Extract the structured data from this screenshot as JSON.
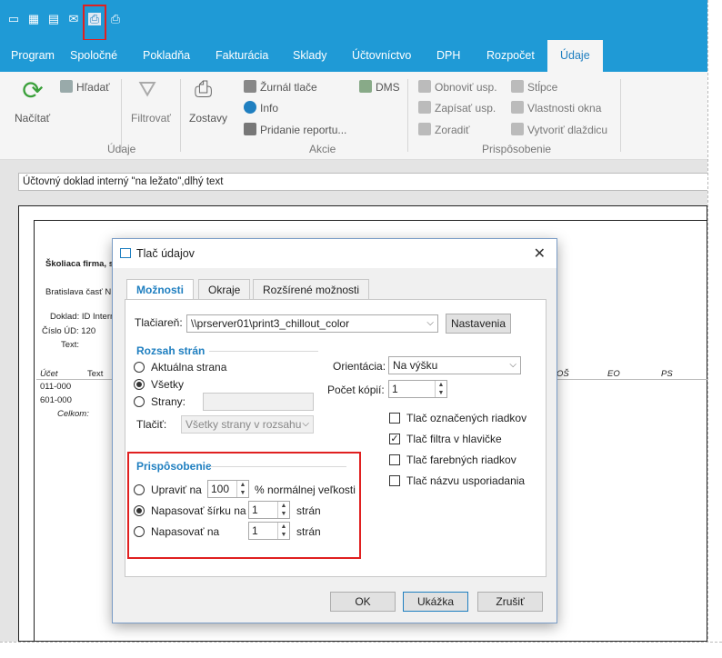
{
  "quick_access": {
    "icons": [
      "window-icon",
      "excel-icon",
      "pdf-icon",
      "mail-icon",
      "print-icon",
      "print-preview-icon"
    ]
  },
  "tabs": [
    "Program",
    "Spoločné",
    "Pokladňa",
    "Fakturácia",
    "Sklady",
    "Účtovníctvo",
    "DPH",
    "Rozpočet",
    "Údaje"
  ],
  "ribbon": {
    "nacitat": "Načítať",
    "hladat": "Hľadať",
    "filtrovat": "Filtrovať",
    "zostavy": "Zostavy",
    "zurnal": "Žurnál tlače",
    "info": "Info",
    "pridanie": "Pridanie reportu...",
    "dms": "DMS",
    "obnovit": "Obnoviť usp.",
    "zapisat": "Zapísať usp.",
    "zoradit": "Zoradiť",
    "stlpce": "Stĺpce",
    "vlastnosti": "Vlastnosti okna",
    "vytvorit": "Vytvoriť dlaždicu",
    "group_udaje": "Údaje",
    "group_akcie": "Akcie",
    "group_prisposobenie": "Prispôsobenie"
  },
  "document": {
    "header": "Účtovný doklad interný \"na ležato\",dlhý text",
    "company": "Školiaca firma, s",
    "address": "Bratislava časť N",
    "doklad": "Doklad: ID Interr",
    "cislo": "Číslo ÚD: 120",
    "text_label": "Text:",
    "col_ucet": "Účet",
    "col_text": "Text",
    "col_os": "OŠ",
    "col_eo": "EO",
    "col_ps": "PS",
    "row1": "011-000",
    "row2": "601-000",
    "celkom": "Celkom:"
  },
  "dialog": {
    "title": "Tlač údajov",
    "tabs": [
      "Možnosti",
      "Okraje",
      "Rozšírené možnosti"
    ],
    "printer_label": "Tlačiareň:",
    "printer_value": "\\\\prserver01\\print3_chillout_color",
    "settings_button": "Nastavenia",
    "range_title": "Rozsah strán",
    "range_current": "Aktuálna strana",
    "range_all": "Všetky",
    "range_pages": "Strany:",
    "print_label": "Tlačiť:",
    "print_value": "Všetky strany v rozsahu",
    "orientation_label": "Orientácia:",
    "orientation_value": "Na výšku",
    "copies_label": "Počet kópií:",
    "copies_value": "1",
    "chk_selected": "Tlač označených riadkov",
    "chk_filter": "Tlač filtra v hlavičke",
    "chk_color": "Tlač farebných riadkov",
    "chk_sort": "Tlač názvu usporiadania",
    "fit_title": "Prispôsobenie",
    "fit_adjust": "Upraviť na",
    "fit_adjust_value": "100",
    "fit_adjust_suffix": "% normálnej veľkosti",
    "fit_width": "Napasovať šírku na",
    "fit_width_value": "1",
    "fit_to": "Napasovať na",
    "fit_to_value": "1",
    "pages_word": "strán",
    "ok": "OK",
    "preview": "Ukážka",
    "cancel": "Zrušiť"
  },
  "colors": {
    "accent": "#1f9ad6",
    "highlight": "#e02020"
  }
}
